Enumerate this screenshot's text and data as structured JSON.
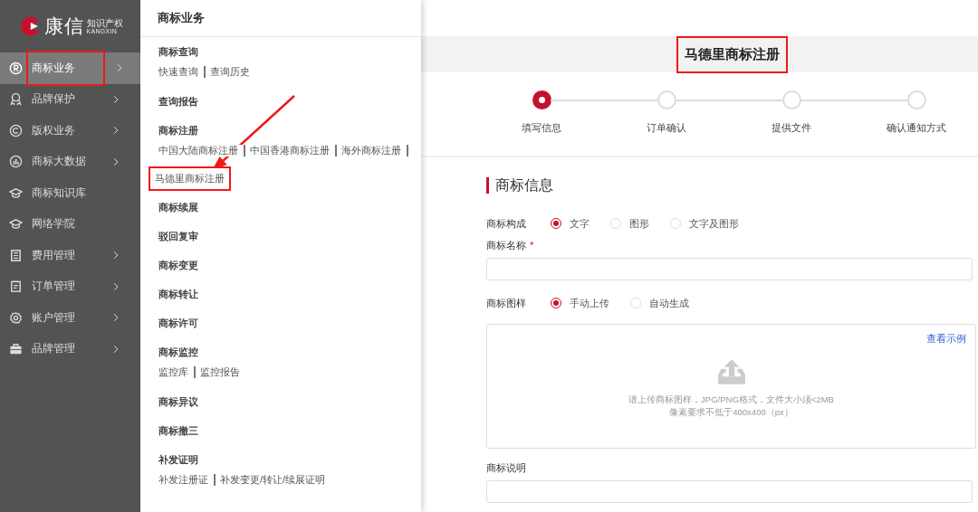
{
  "logo": {
    "name": "康信",
    "tagline": "知识产权",
    "latin": "KANGXIN"
  },
  "nav": [
    {
      "label": "商标业务",
      "selected": true,
      "highlighted": true,
      "expandable": true
    },
    {
      "label": "品牌保护",
      "selected": false,
      "highlighted": false,
      "expandable": true
    },
    {
      "label": "版权业务",
      "selected": false,
      "highlighted": false,
      "expandable": true
    },
    {
      "label": "商标大数据",
      "selected": false,
      "highlighted": false,
      "expandable": true
    },
    {
      "label": "商标知识库",
      "selected": false,
      "highlighted": false,
      "expandable": false
    },
    {
      "label": "网络学院",
      "selected": false,
      "highlighted": false,
      "expandable": false
    },
    {
      "label": "费用管理",
      "selected": false,
      "highlighted": false,
      "expandable": true
    },
    {
      "label": "订单管理",
      "selected": false,
      "highlighted": false,
      "expandable": true
    },
    {
      "label": "账户管理",
      "selected": false,
      "highlighted": false,
      "expandable": true
    },
    {
      "label": "品牌管理",
      "selected": false,
      "highlighted": false,
      "expandable": true
    }
  ],
  "submenu": {
    "title": "商标业务",
    "groups": [
      {
        "title": "商标查询",
        "link_rows": [
          {
            "links": [
              {
                "label": "快速查询",
                "highlighted": false
              },
              {
                "label": "查询历史",
                "highlighted": false
              }
            ],
            "trailing_bar": false
          }
        ]
      },
      {
        "title": "查询报告"
      },
      {
        "title": "商标注册",
        "link_rows": [
          {
            "links": [
              {
                "label": "中国大陆商标注册",
                "highlighted": false
              },
              {
                "label": "中国香港商标注册",
                "highlighted": false
              },
              {
                "label": "海外商标注册",
                "highlighted": false
              }
            ],
            "trailing_bar": true
          },
          {
            "links": [
              {
                "label": "马德里商标注册",
                "highlighted": true
              }
            ],
            "trailing_bar": false
          }
        ]
      },
      {
        "title": "商标续展"
      },
      {
        "title": "驳回复审"
      },
      {
        "title": "商标变更"
      },
      {
        "title": "商标转让"
      },
      {
        "title": "商标许可"
      },
      {
        "title": "商标监控",
        "link_rows": [
          {
            "links": [
              {
                "label": "监控库",
                "highlighted": false
              },
              {
                "label": "监控报告",
                "highlighted": false
              }
            ],
            "trailing_bar": false
          }
        ]
      },
      {
        "title": "商标异议"
      },
      {
        "title": "商标撤三"
      },
      {
        "title": "补发证明",
        "link_rows": [
          {
            "links": [
              {
                "label": "补发注册证",
                "highlighted": false
              },
              {
                "label": "补发变更/转让/续展证明",
                "highlighted": false
              }
            ],
            "trailing_bar": false
          }
        ]
      }
    ]
  },
  "annotation_arrow": true,
  "page": {
    "title": "马德里商标注册",
    "title_highlighted": true,
    "steps": [
      {
        "label": "填写信息",
        "selected": true
      },
      {
        "label": "订单确认",
        "selected": false
      },
      {
        "label": "提供文件",
        "selected": false
      },
      {
        "label": "确认通知方式",
        "selected": false
      }
    ],
    "section_title": "商标信息",
    "form": [
      {
        "kind": "radio",
        "label": "商标构成",
        "options": [
          {
            "label": "文字",
            "selected": true
          },
          {
            "label": "图形",
            "selected": false
          },
          {
            "label": "文字及图形",
            "selected": false
          }
        ]
      },
      {
        "kind": "text",
        "label": "商标名称",
        "required_mark": "*"
      },
      {
        "kind": "radio",
        "label": "商标图样",
        "options": [
          {
            "label": "手动上传",
            "selected": true
          },
          {
            "label": "自动生成",
            "selected": false
          }
        ]
      },
      {
        "kind": "upload",
        "link": "查看示例",
        "hint_lines": [
          "请上传商标图样，JPG/PNG格式，文件大小须<2MB",
          "像素要求不低于400x400（px）"
        ]
      },
      {
        "kind": "text",
        "label": "商标说明"
      }
    ]
  }
}
